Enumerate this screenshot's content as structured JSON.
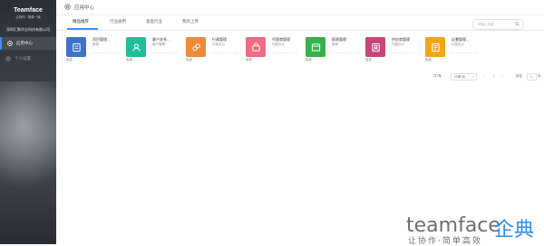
{
  "brand": {
    "name": "Teamface",
    "slogan": "让协作 · 简单一致"
  },
  "company": "深圳汇聚华企科技有限公司",
  "nav": [
    {
      "label": "应用中心",
      "icon": "app-center-icon",
      "active": true
    },
    {
      "label": "个人设置",
      "icon": "settings-icon",
      "active": false
    }
  ],
  "header": {
    "title": "应用中心"
  },
  "tabs": [
    {
      "label": "精品推荐",
      "active": true
    },
    {
      "label": "行业通用",
      "active": false
    },
    {
      "label": "垂直行业",
      "active": false
    },
    {
      "label": "我的上传",
      "active": false
    }
  ],
  "search": {
    "placeholder": "请输入关键"
  },
  "apps": [
    {
      "name": "项目管理...",
      "category": "其他",
      "price": "免费",
      "color": "#3d74c9",
      "icon": "project-icon"
    },
    {
      "name": "客户关系...",
      "category": "客户管理",
      "price": "免费",
      "color": "#1fbd9b",
      "icon": "customer-icon"
    },
    {
      "name": "行政管理",
      "category": "行政办公",
      "price": "免费",
      "color": "#f0893a",
      "icon": "admin-icon"
    },
    {
      "name": "代理商管理",
      "category": "行政办公",
      "price": "免费",
      "color": "#ef6a83",
      "icon": "agent-icon"
    },
    {
      "name": "报表管理",
      "category": "其他",
      "price": "免费",
      "color": "#35b24a",
      "icon": "report-icon"
    },
    {
      "name": "供应商管理",
      "category": "行政办公",
      "price": "免费",
      "color": "#c8457a",
      "icon": "supplier-icon"
    },
    {
      "name": "证書管理...",
      "category": "行政办公",
      "price": "免费",
      "color": "#f1a519",
      "icon": "certificate-icon"
    }
  ],
  "pagination": {
    "total_text": "共7条",
    "page_size": "20条/页",
    "current_page": "1",
    "goto_label": "前往",
    "goto_value": "1",
    "goto_unit": "页"
  },
  "watermark": {
    "latin": "teamface",
    "cn": "企典",
    "slogan": "让协作·简单高效"
  }
}
